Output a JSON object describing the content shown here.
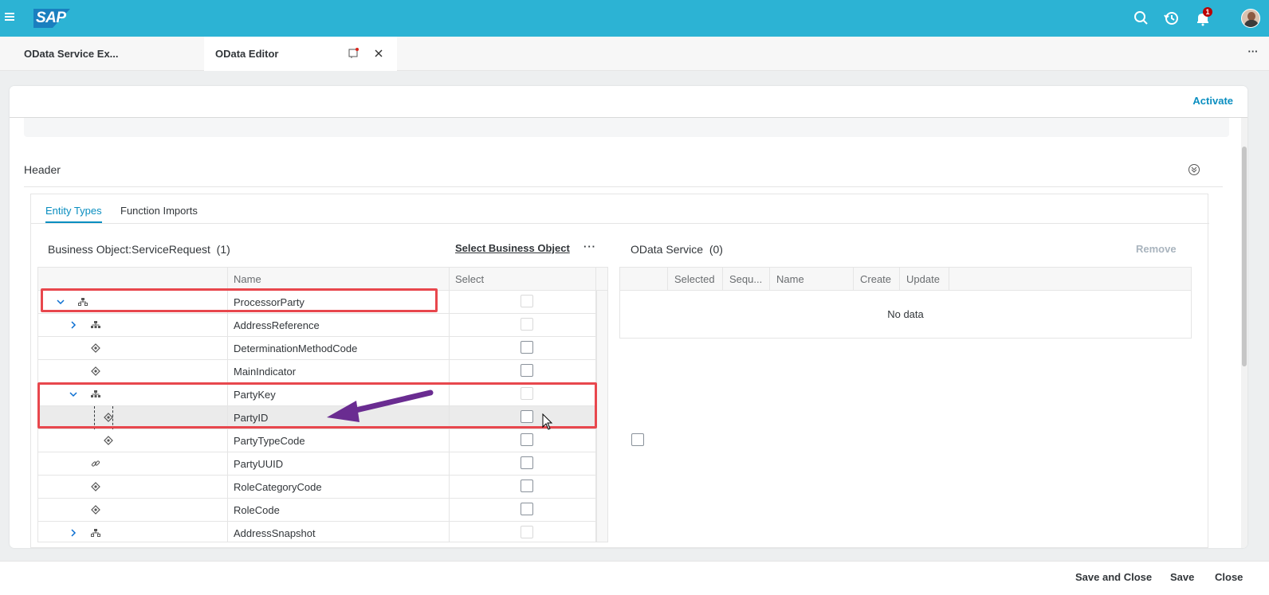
{
  "shell": {
    "logo_text": "SAP",
    "notification_count": "1",
    "icons": [
      "menu-icon",
      "search-icon",
      "history-icon",
      "bell-icon",
      "avatar"
    ]
  },
  "app_tabs": [
    {
      "label": "OData Service Ex...",
      "active": false
    },
    {
      "label": "OData Editor",
      "active": true
    }
  ],
  "page": {
    "activate_label": "Activate",
    "section_title": "Header"
  },
  "inner_tabs": [
    {
      "label": "Entity Types",
      "active": true
    },
    {
      "label": "Function Imports",
      "active": false
    }
  ],
  "business_object": {
    "title": "Business Object:ServiceRequest  (1)",
    "select_label": "Select Business Object",
    "more_label": "···",
    "columns": [
      "",
      "Name",
      "Select"
    ],
    "rows": [
      {
        "name": "ProcessorParty",
        "level": 0,
        "expander": "expanded",
        "icon": "entity-icon",
        "checkbox_enabled": false
      },
      {
        "name": "AddressReference",
        "level": 1,
        "expander": "collapsed",
        "icon": "hierarchy-icon",
        "checkbox_enabled": false
      },
      {
        "name": "DeterminationMethodCode",
        "level": 1,
        "expander": "none",
        "icon": "attribute-icon",
        "checkbox_enabled": true
      },
      {
        "name": "MainIndicator",
        "level": 1,
        "expander": "none",
        "icon": "attribute-icon",
        "checkbox_enabled": true
      },
      {
        "name": "PartyKey",
        "level": 1,
        "expander": "expanded",
        "icon": "hierarchy-icon",
        "checkbox_enabled": false
      },
      {
        "name": "PartyID",
        "level": 2,
        "expander": "none",
        "icon": "attribute-icon",
        "checkbox_enabled": true,
        "highlighted": true
      },
      {
        "name": "PartyTypeCode",
        "level": 2,
        "expander": "none",
        "icon": "attribute-icon",
        "checkbox_enabled": true
      },
      {
        "name": "PartyUUID",
        "level": 1,
        "expander": "none",
        "icon": "link-icon",
        "checkbox_enabled": true
      },
      {
        "name": "RoleCategoryCode",
        "level": 1,
        "expander": "none",
        "icon": "attribute-icon",
        "checkbox_enabled": true
      },
      {
        "name": "RoleCode",
        "level": 1,
        "expander": "none",
        "icon": "attribute-icon",
        "checkbox_enabled": true
      },
      {
        "name": "AddressSnapshot",
        "level": 1,
        "expander": "collapsed",
        "icon": "entity-icon",
        "checkbox_enabled": false
      }
    ]
  },
  "odata_service": {
    "title": "OData Service  (0)",
    "remove_label": "Remove",
    "columns": [
      "",
      "Selected",
      "Sequ...",
      "Name",
      "Create",
      "Update"
    ],
    "empty_text": "No data"
  },
  "footer": {
    "save_close_label": "Save and Close",
    "save_label": "Save",
    "close_label": "Close"
  },
  "colors": {
    "shell": "#2cb3d4",
    "accent": "#0a8ec0",
    "annotation_box": "#e8474d",
    "annotation_arrow": "#6a2c91"
  }
}
